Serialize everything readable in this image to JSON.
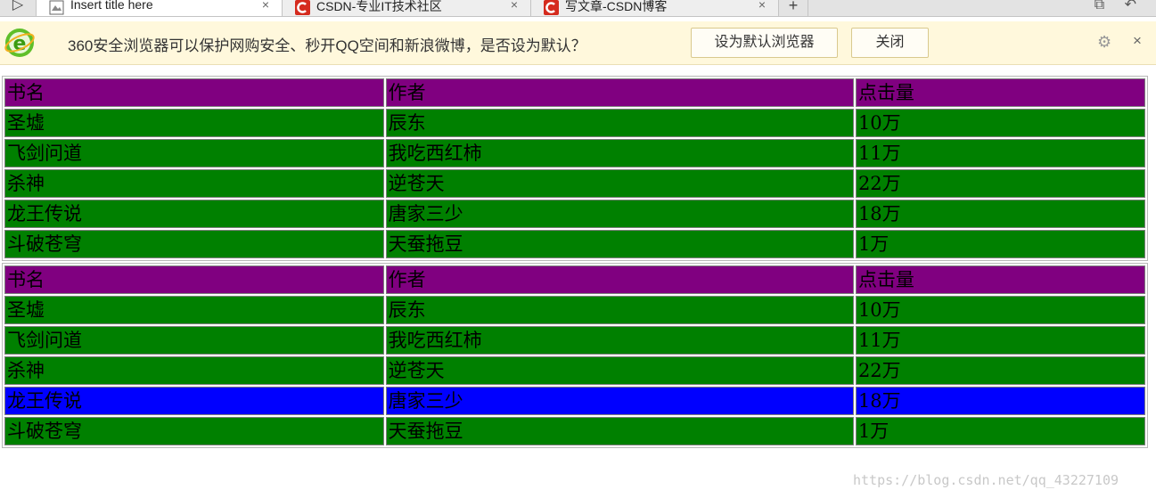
{
  "tabs": [
    {
      "title": "Insert title here",
      "close": "×",
      "active": true,
      "icon": "document-icon"
    },
    {
      "title": "CSDN-专业IT技术社区",
      "close": "×",
      "active": false,
      "icon": "csdn-icon"
    },
    {
      "title": "写文章-CSDN博客",
      "close": "×",
      "active": false,
      "icon": "csdn-icon"
    }
  ],
  "toolbar": {
    "new_tab": "+",
    "back": "▷",
    "restore": "⧉",
    "undo": "↶"
  },
  "infobar": {
    "message": "360安全浏览器可以保护网购安全、秒开QQ空间和新浪微博，是否设为默认？",
    "set_default_label": "设为默认浏览器",
    "close_label": "关闭",
    "gear": "⚙",
    "dismiss": "×"
  },
  "tables": [
    {
      "headers": [
        "书名",
        "作者",
        "点击量"
      ],
      "rows": [
        [
          "圣墟",
          "辰东",
          "10万"
        ],
        [
          "飞剑问道",
          "我吃西红柿",
          "11万"
        ],
        [
          "杀神",
          "逆苍天",
          "22万"
        ],
        [
          "龙王传说",
          "唐家三少",
          "18万"
        ],
        [
          "斗破苍穹",
          "天蚕拖豆",
          "1万"
        ]
      ]
    },
    {
      "headers": [
        "书名",
        "作者",
        "点击量"
      ],
      "rows": [
        [
          "圣墟",
          "辰东",
          "10万"
        ],
        [
          "飞剑问道",
          "我吃西红柿",
          "11万"
        ],
        [
          "杀神",
          "逆苍天",
          "22万"
        ],
        [
          "龙王传说",
          "唐家三少",
          "18万"
        ],
        [
          "斗破苍穹",
          "天蚕拖豆",
          "1万"
        ]
      ],
      "highlight_row": 3
    }
  ],
  "colors": {
    "header": "#800080",
    "row": "#008000",
    "highlight": "#0000ff"
  },
  "watermark": "https://blog.csdn.net/qq_43227109"
}
